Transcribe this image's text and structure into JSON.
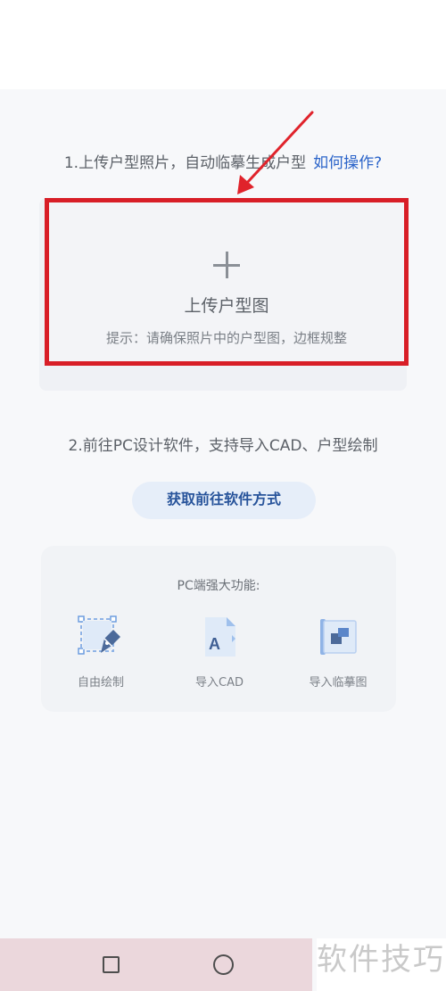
{
  "step1": {
    "text": "1.上传户型照片，自动临摹生成户型",
    "link": "如何操作?"
  },
  "upload": {
    "icon": "plus-icon",
    "title": "上传户型图",
    "hint": "提示：请确保照片中的户型图，边框规整"
  },
  "step2": {
    "text": "2.前往PC设计软件，支持导入CAD、户型绘制",
    "button": "获取前往软件方式"
  },
  "pc": {
    "title": "PC端强大功能:",
    "features": [
      {
        "label": "自由绘制",
        "icon": "free-draw-icon"
      },
      {
        "label": "导入CAD",
        "icon": "import-cad-icon"
      },
      {
        "label": "导入临摹图",
        "icon": "import-trace-icon"
      }
    ]
  },
  "colors": {
    "accent_link": "#2b64c9",
    "highlight_border": "#d81e27",
    "button_bg": "#e6eef9",
    "button_text": "#28549b",
    "navbar_bg": "#ebd7dc"
  },
  "navbar": {
    "recent_icon": "square-icon",
    "home_icon": "circle-icon"
  },
  "watermark": "软件技巧"
}
